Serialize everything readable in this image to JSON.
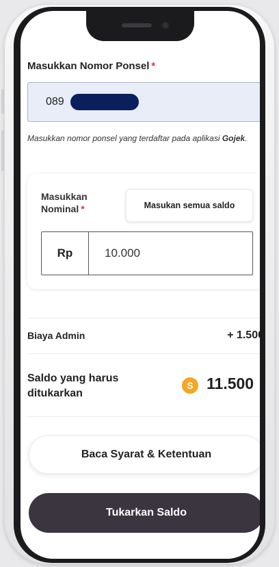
{
  "form": {
    "phone_label": "Masukkan Nomor Ponsel",
    "required_mark": "*",
    "phone_value": "089",
    "helper_text_prefix": "Masukkan nomor ponsel yang terdaftar pada aplikasi ",
    "helper_text_app": "Gojek",
    "helper_text_suffix": "."
  },
  "nominal": {
    "label": "Masukkan Nominal",
    "required_mark": "*",
    "all_balance_button": "Masukan semua saldo",
    "currency": "Rp",
    "amount": "10.000"
  },
  "summary": {
    "admin_label": "Biaya Admin",
    "admin_value": "+ 1.500",
    "total_label": "Saldo yang harus ditukarkan",
    "coin_icon_glyph": "S",
    "total_value": "11.500"
  },
  "actions": {
    "terms_button": "Baca Syarat & Ketentuan",
    "submit_button": "Tukarkan Saldo"
  },
  "colors": {
    "required": "#e0334a",
    "phone_input_bg": "#e8edf8",
    "coin": "#f5a623",
    "submit_bg": "#3b3540"
  },
  "icons": {
    "coin": "coin-icon"
  }
}
